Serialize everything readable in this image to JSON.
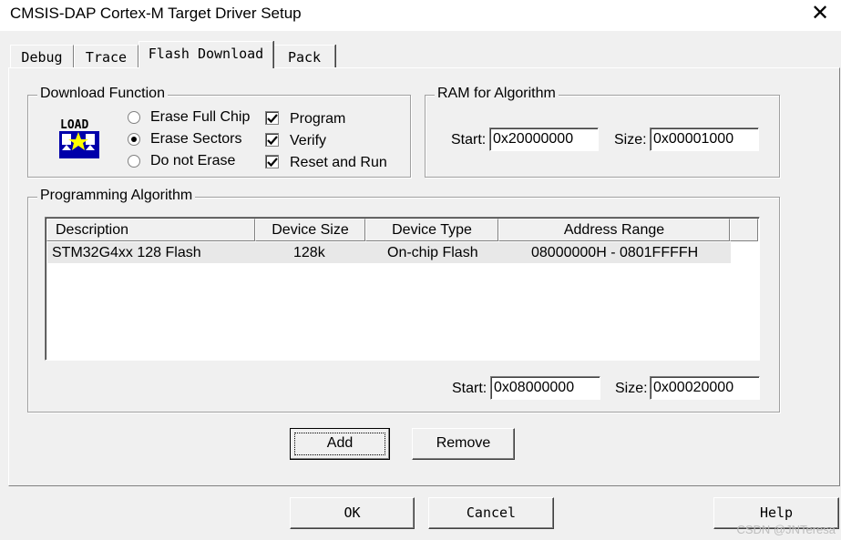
{
  "window": {
    "title": "CMSIS-DAP Cortex-M Target Driver Setup",
    "close_glyph": "✕"
  },
  "tabs": [
    {
      "label": "Debug",
      "active": false
    },
    {
      "label": "Trace",
      "active": false
    },
    {
      "label": "Flash Download",
      "active": true
    },
    {
      "label": "Pack",
      "active": false
    }
  ],
  "download_function": {
    "label": "Download Function",
    "icon": "load-icon",
    "icon_text": "LOAD",
    "radios": [
      {
        "label": "Erase Full Chip",
        "checked": false
      },
      {
        "label": "Erase Sectors",
        "checked": true
      },
      {
        "label": "Do not Erase",
        "checked": false
      }
    ],
    "checks": [
      {
        "label": "Program",
        "checked": true
      },
      {
        "label": "Verify",
        "checked": true
      },
      {
        "label": "Reset and Run",
        "checked": true
      }
    ]
  },
  "ram": {
    "label": "RAM for Algorithm",
    "start_label": "Start:",
    "start_value": "0x20000000",
    "size_label": "Size:",
    "size_value": "0x00001000"
  },
  "programming_algorithm": {
    "label": "Programming Algorithm",
    "columns": [
      "Description",
      "Device Size",
      "Device Type",
      "Address Range"
    ],
    "rows": [
      {
        "description": "STM32G4xx 128 Flash",
        "device_size": "128k",
        "device_type": "On-chip Flash",
        "address_range": "08000000H - 0801FFFFH"
      }
    ],
    "start_label": "Start:",
    "start_value": "0x08000000",
    "size_label": "Size:",
    "size_value": "0x00020000"
  },
  "buttons": {
    "add": "Add",
    "remove": "Remove",
    "ok": "OK",
    "cancel": "Cancel",
    "help": "Help"
  },
  "watermark": "CSDN @JNTeresa"
}
